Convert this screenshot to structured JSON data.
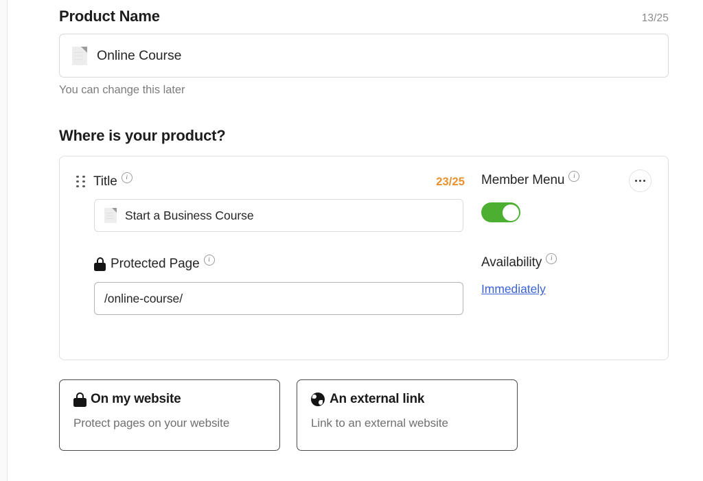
{
  "product_name_section": {
    "title": "Product Name",
    "char_counter": "13/25",
    "field_icon": "document-icon",
    "field_value": "Online Course",
    "helper_text": "You can change this later"
  },
  "where_section": {
    "title": "Where is your product?",
    "item": {
      "drag_handle_icon": "drag-handle-icon",
      "title_label": "Title",
      "title_info_icon": "info-icon",
      "title_char_counter": "23/25",
      "title_input_icon": "document-icon",
      "title_input_value": "Start a Business Course",
      "protected_page_icon": "lock-icon",
      "protected_page_label": "Protected Page",
      "protected_page_info_icon": "info-icon",
      "slug_value": "/online-course/",
      "member_menu_label": "Member Menu",
      "member_menu_info_icon": "info-icon",
      "kebab_icon": "more-options-icon",
      "member_menu_toggle_state": "on",
      "availability_label": "Availability",
      "availability_info_icon": "info-icon",
      "availability_value": "Immediately"
    }
  },
  "option_cards": [
    {
      "icon": "lock-icon",
      "title": "On my website",
      "subtitle": "Protect pages on your website"
    },
    {
      "icon": "globe-icon",
      "title": "An external link",
      "subtitle": "Link to an external website"
    }
  ],
  "colors": {
    "accent_orange": "#e8912d",
    "toggle_green": "#4caf31",
    "link_blue": "#3b62d6",
    "text_primary": "#1d1d1d",
    "text_muted": "#7d7d7d"
  }
}
